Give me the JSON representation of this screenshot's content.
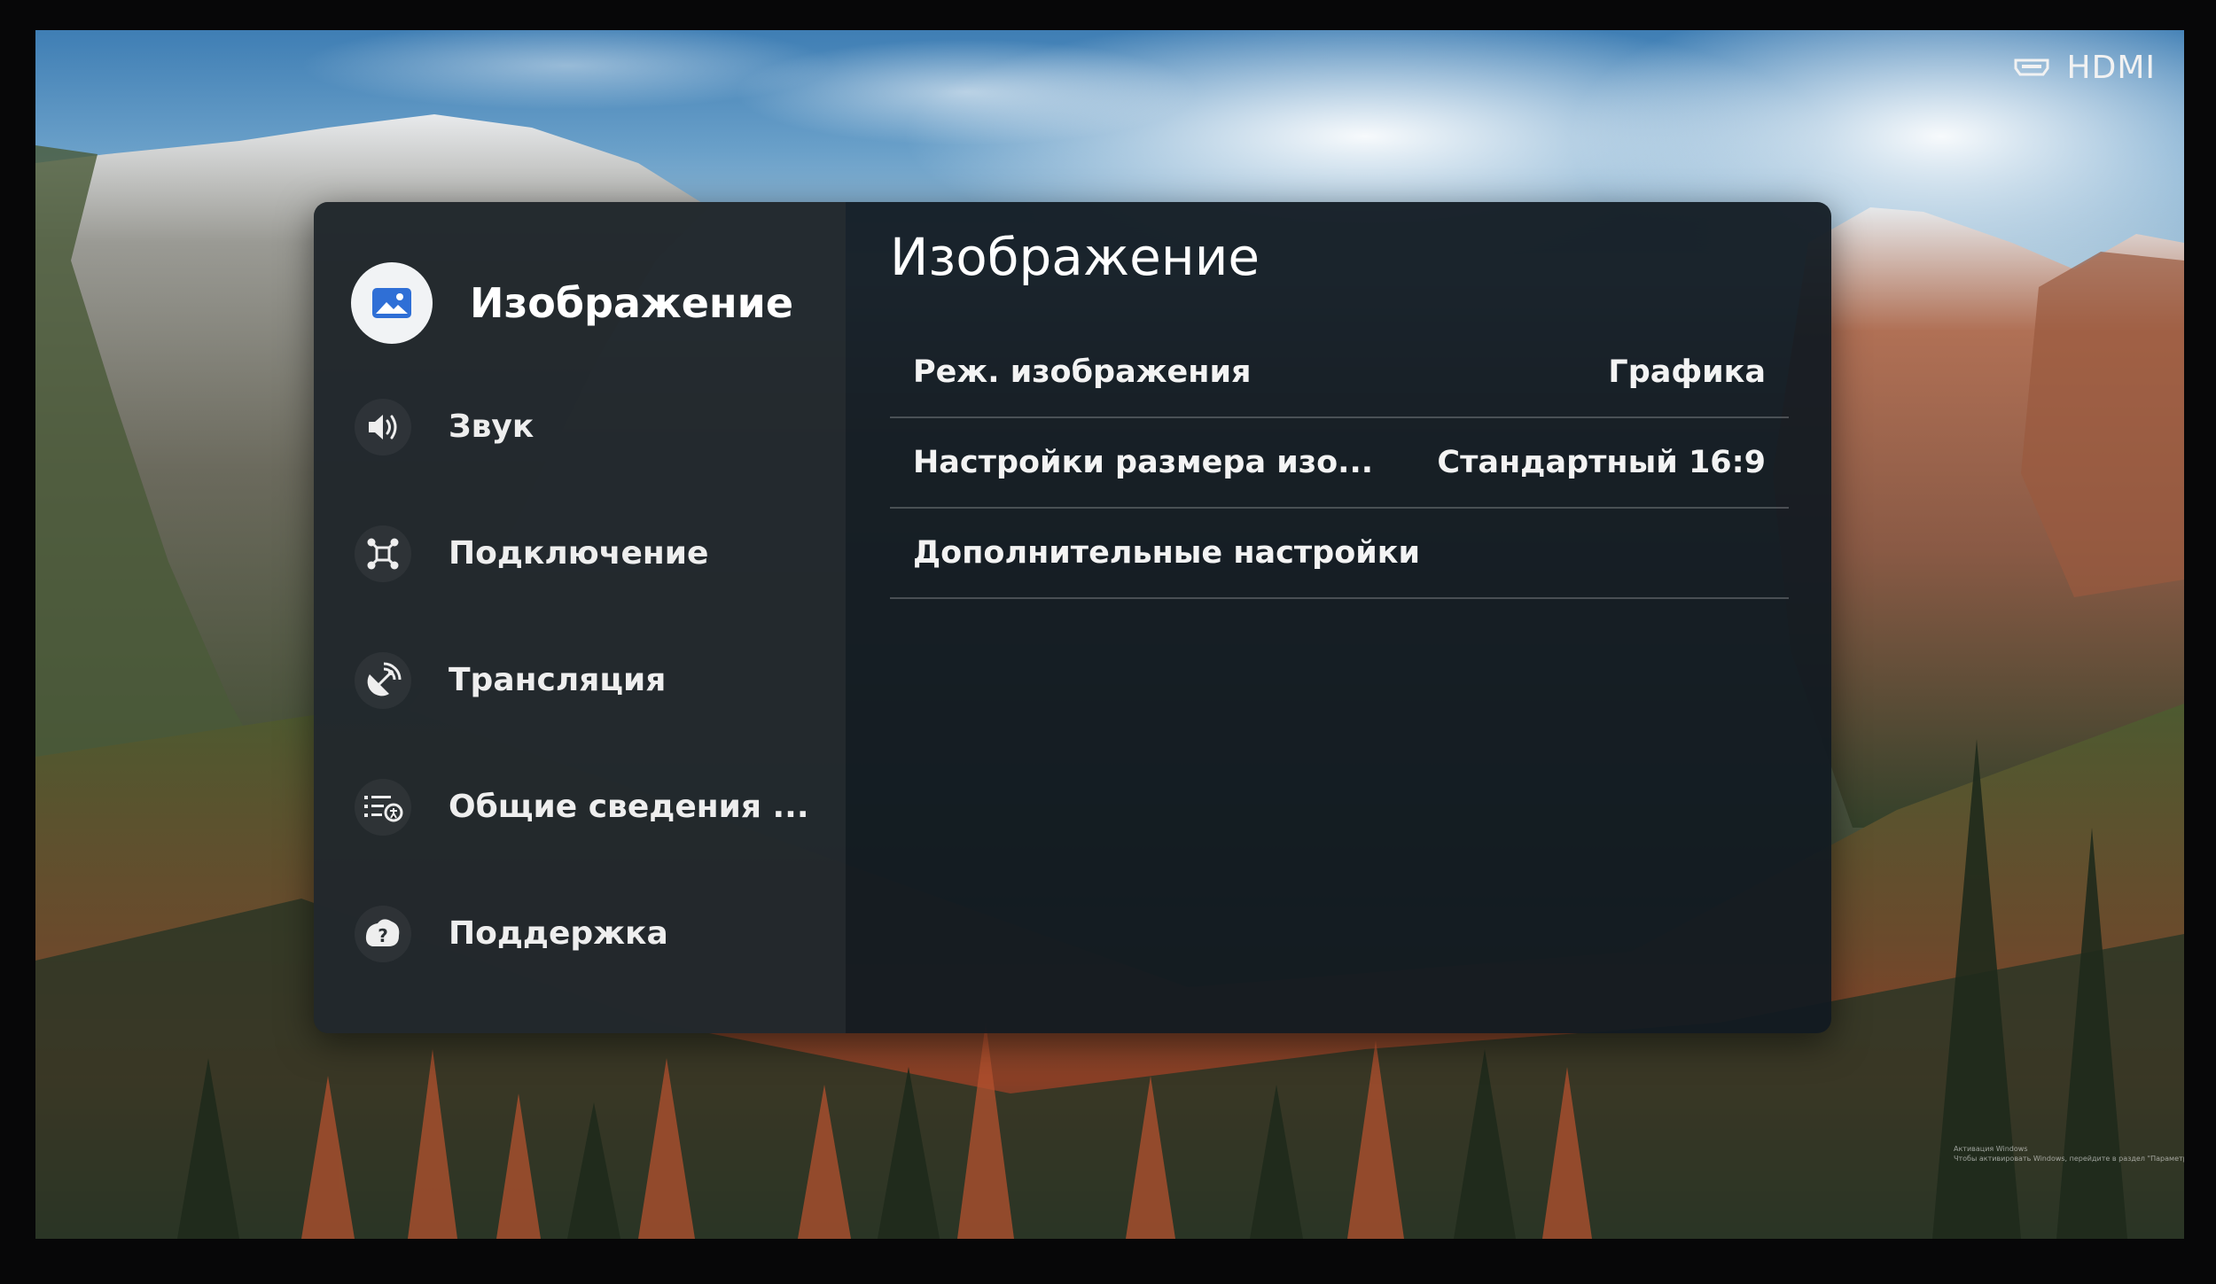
{
  "status": {
    "input_source": "HDMI",
    "input_icon": "hdmi-icon"
  },
  "sidebar": {
    "items": [
      {
        "label": "Изображение",
        "icon": "picture-icon",
        "active": true
      },
      {
        "label": "Звук",
        "icon": "speaker-icon"
      },
      {
        "label": "Подключение",
        "icon": "connection-icon"
      },
      {
        "label": "Трансляция",
        "icon": "broadcast-icon"
      },
      {
        "label": "Общие сведения ...",
        "icon": "general-list-icon"
      },
      {
        "label": "Поддержка",
        "icon": "support-question-icon"
      }
    ]
  },
  "main": {
    "title": "Изображение",
    "rows": [
      {
        "label": "Реж. изображения",
        "value": "Графика"
      },
      {
        "label": "Настройки размера изо...",
        "value": "Стандартный 16:9"
      },
      {
        "label": "Дополнительные настройки",
        "value": ""
      }
    ]
  },
  "watermark": {
    "line1": "Активация Windows",
    "line2": "Чтобы активировать Windows, перейдите в раздел \"Параметры\"."
  },
  "colors": {
    "panel_bg": "#111a21",
    "sidebar_bg": "#2c3134",
    "active_icon_bg": "#f1f3f5",
    "active_icon_fg": "#2f6fd6",
    "text": "#f3f3f3"
  }
}
